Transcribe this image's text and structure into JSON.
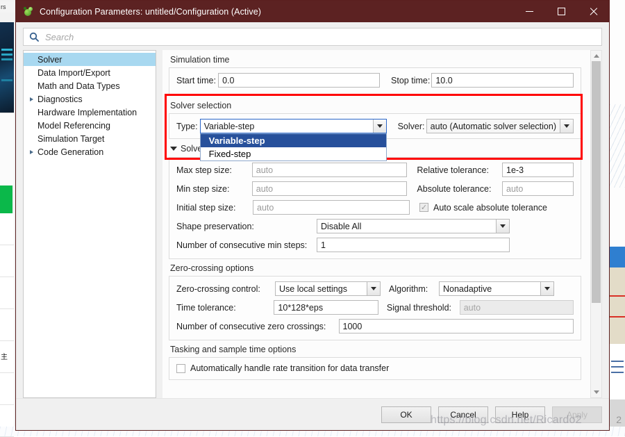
{
  "window": {
    "title": "Configuration Parameters: untitled/Configuration (Active)",
    "icon": "simulink-icon",
    "minimize": "—",
    "maximize": "□",
    "close": "✕",
    "titlebar_color": "#5c2222"
  },
  "search": {
    "placeholder": "Search",
    "value": "",
    "icon": "search-icon"
  },
  "sidebar": {
    "items": [
      {
        "label": "Solver",
        "expandable": false,
        "selected": true
      },
      {
        "label": "Data Import/Export",
        "expandable": false,
        "selected": false
      },
      {
        "label": "Math and Data Types",
        "expandable": false,
        "selected": false
      },
      {
        "label": "Diagnostics",
        "expandable": true,
        "selected": false
      },
      {
        "label": "Hardware Implementation",
        "expandable": false,
        "selected": false
      },
      {
        "label": "Model Referencing",
        "expandable": false,
        "selected": false
      },
      {
        "label": "Simulation Target",
        "expandable": false,
        "selected": false
      },
      {
        "label": "Code Generation",
        "expandable": true,
        "selected": false
      }
    ]
  },
  "simulation_time": {
    "title": "Simulation time",
    "start_label": "Start time:",
    "start_value": "0.0",
    "stop_label": "Stop time:",
    "stop_value": "10.0"
  },
  "solver_selection": {
    "title": "Solver selection",
    "highlight_color": "#ff0000",
    "type_label": "Type:",
    "type_value": "Variable-step",
    "type_dropdown_open": true,
    "type_options": [
      {
        "label": "Variable-step",
        "selected": true
      },
      {
        "label": "Fixed-step",
        "selected": false
      }
    ],
    "solver_label": "Solver:",
    "solver_value": "auto (Automatic solver selection)"
  },
  "solver_details": {
    "header": "Solver details",
    "max_step_label": "Max step size:",
    "max_step_value": "auto",
    "relative_tol_label": "Relative tolerance:",
    "relative_tol_value": "1e-3",
    "min_step_label": "Min step size:",
    "min_step_value": "auto",
    "absolute_tol_label": "Absolute tolerance:",
    "absolute_tol_value": "auto",
    "initial_step_label": "Initial step size:",
    "initial_step_value": "auto",
    "auto_scale_label": "Auto scale absolute tolerance",
    "auto_scale_checked": true,
    "shape_pres_label": "Shape preservation:",
    "shape_pres_value": "Disable All",
    "min_steps_label": "Number of consecutive min steps:",
    "min_steps_value": "1"
  },
  "zero_crossing": {
    "title": "Zero-crossing options",
    "control_label": "Zero-crossing control:",
    "control_value": "Use local settings",
    "algorithm_label": "Algorithm:",
    "algorithm_value": "Nonadaptive",
    "time_tol_label": "Time tolerance:",
    "time_tol_value": "10*128*eps",
    "signal_thr_label": "Signal threshold:",
    "signal_thr_value": "auto",
    "num_crossings_label": "Number of consecutive zero crossings:",
    "num_crossings_value": "1000"
  },
  "tasking": {
    "title": "Tasking and sample time options",
    "checkbox_label": "Automatically handle rate transition for data transfer",
    "checkbox_checked": false
  },
  "footer": {
    "ok": "OK",
    "cancel": "Cancel",
    "help": "Help",
    "apply": "Apply"
  },
  "overlay": {
    "watermark": "https://blog.csdn.net/Ricardo2"
  },
  "desktop": {
    "left_tab_text": "rs",
    "right_number": "2",
    "left_cjk": "主"
  }
}
